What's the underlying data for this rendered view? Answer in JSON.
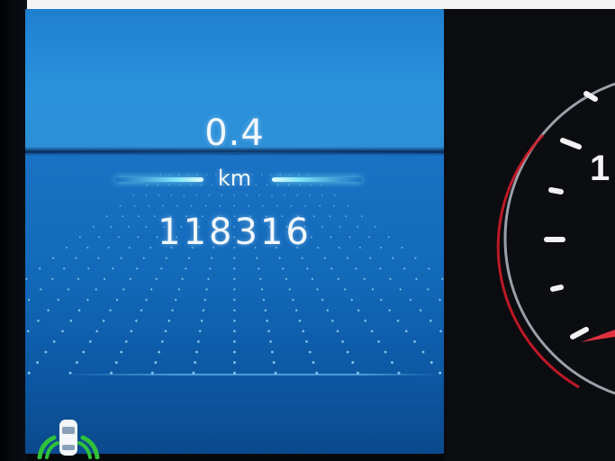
{
  "trip": {
    "distance": "0.4",
    "unit": "km"
  },
  "odometer": {
    "total": "118316"
  },
  "indicators": {
    "parking_sensor_icon": "parking-sensor-car-icon"
  },
  "gauge": {
    "visible_numerals": [
      "1"
    ],
    "accent_color": "#d11a2a",
    "needle_color": "#e03040"
  },
  "colors": {
    "display_blue": "#1769b7",
    "text": "#f2f8ff",
    "glow": "#8cf0ff",
    "parking_green": "#2fc13a"
  }
}
